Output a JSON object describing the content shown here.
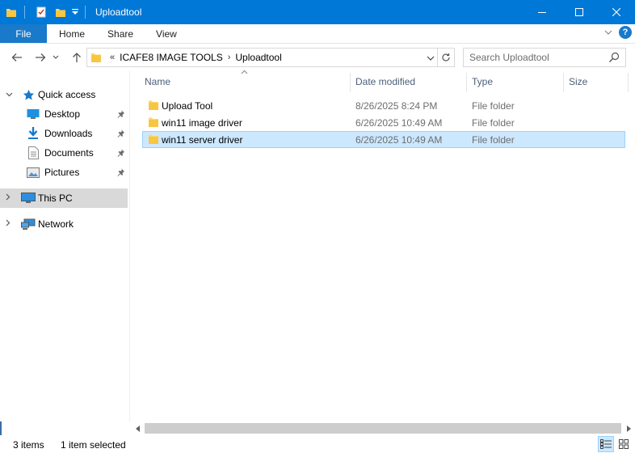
{
  "window": {
    "title": "Uploadtool",
    "accent": "#0078d7"
  },
  "ribbon": {
    "tabs": [
      "File",
      "Home",
      "Share",
      "View"
    ]
  },
  "address": {
    "overflow": "«",
    "segments": [
      "ICAFE8 IMAGE TOOLS",
      "Uploadtool"
    ],
    "separator": "›"
  },
  "search": {
    "placeholder": "Search Uploadtool"
  },
  "nav": {
    "items": [
      {
        "label": "Quick access",
        "icon": "star-icon"
      },
      {
        "label": "Desktop",
        "icon": "desktop-icon",
        "pinned": true
      },
      {
        "label": "Downloads",
        "icon": "download-icon",
        "pinned": true
      },
      {
        "label": "Documents",
        "icon": "document-icon",
        "pinned": true
      },
      {
        "label": "Pictures",
        "icon": "pictures-icon",
        "pinned": true
      },
      {
        "label": "This PC",
        "icon": "computer-icon",
        "selected": true
      },
      {
        "label": "Network",
        "icon": "network-icon"
      }
    ]
  },
  "columns": {
    "name": "Name",
    "date": "Date modified",
    "type": "Type",
    "size": "Size"
  },
  "files": [
    {
      "name": "Upload Tool",
      "date": "8/26/2025 8:24 PM",
      "type": "File folder",
      "size": ""
    },
    {
      "name": "win11 image driver",
      "date": "6/26/2025 10:49 AM",
      "type": "File folder",
      "size": ""
    },
    {
      "name": "win11 server driver",
      "date": "6/26/2025 10:49 AM",
      "type": "File folder",
      "size": "",
      "selected": true
    }
  ],
  "status": {
    "count": "3 items",
    "selection": "1 item selected"
  }
}
